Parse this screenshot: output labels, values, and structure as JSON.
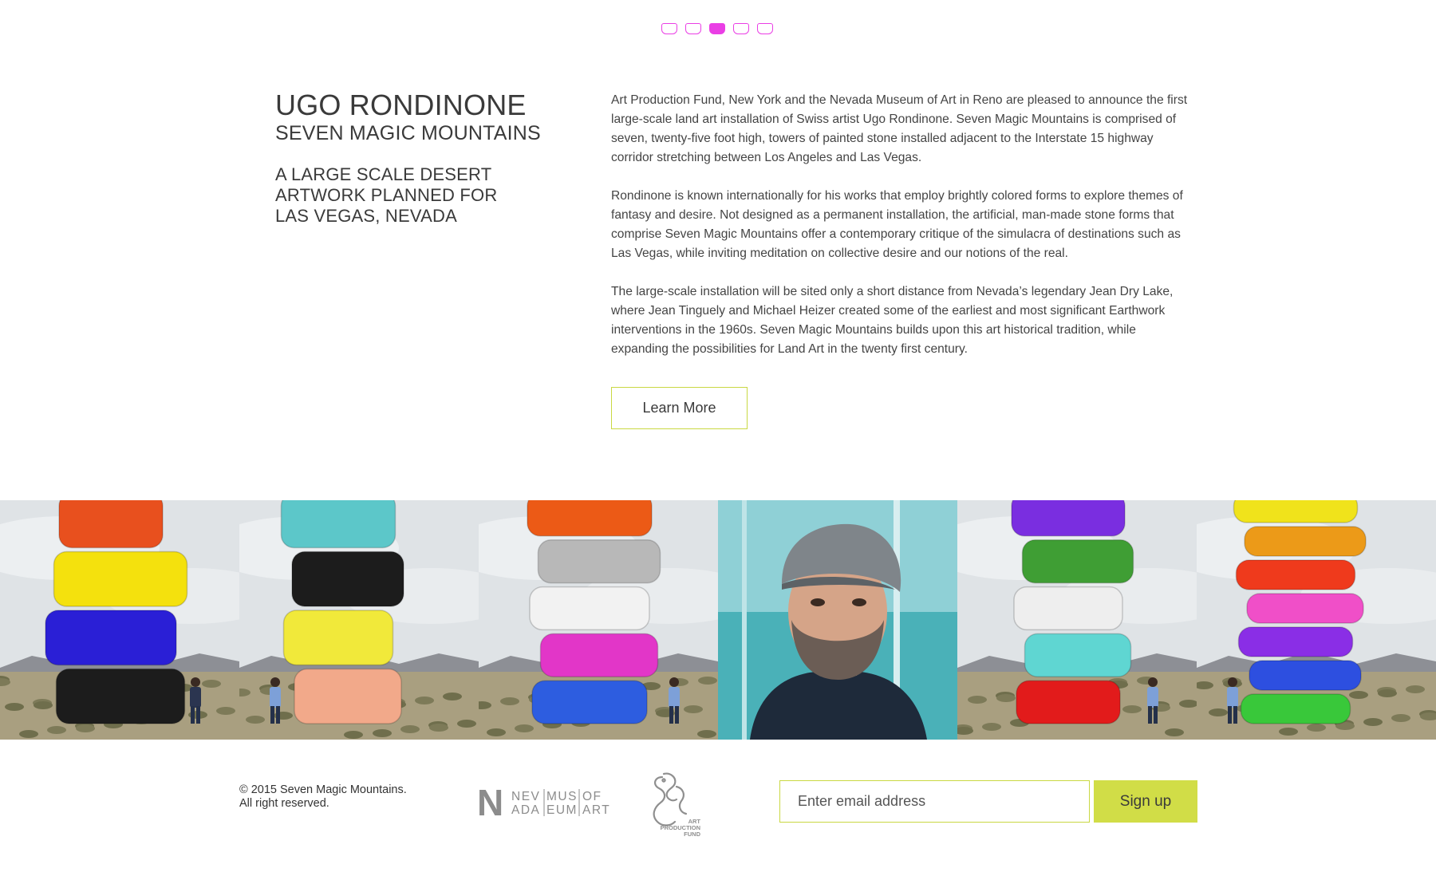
{
  "slider": {
    "count": 5,
    "active_index": 2,
    "accent": "#ea3ee5"
  },
  "heading": {
    "artist": "UGO RONDINONE",
    "title": "SEVEN MAGIC MOUNTAINS",
    "subtitle_lines": [
      "A LARGE SCALE DESERT",
      "ARTWORK PLANNED FOR",
      "LAS VEGAS, NEVADA"
    ]
  },
  "body": {
    "paragraphs": [
      "Art Production Fund, New York and the Nevada Museum of Art in Reno are pleased to announce the first large-scale land art installation of Swiss artist Ugo Rondinone. Seven Magic Mountains is comprised of seven, twenty-five foot high, towers of painted stone installed adjacent to the Interstate 15 highway corridor stretching between Los Angeles and Las Vegas.",
      "Rondinone is known internationally for his works that employ brightly colored forms to explore themes of fantasy and desire. Not designed as a permanent installation, the artificial, man-made stone forms that comprise Seven Magic Mountains offer a contemporary critique of the simulacra of destinations such as Las Vegas, while inviting meditation on collective desire and our notions of the real.",
      "The large-scale installation will be sited only a short distance from Nevada’s legendary Jean Dry Lake, where Jean Tinguely and Michael Heizer created some of the earliest and most significant Earthwork interventions in the 1960s. Seven Magic Mountains builds upon this art historical tradition, while expanding the possibilities for Land Art in the twenty first century."
    ],
    "learn_more_label": "Learn More"
  },
  "gallery": {
    "tiles": [
      {
        "kind": "tower",
        "stones": [
          "#e8501e",
          "#f4e10d",
          "#2a1fd6",
          "#1c1c1c"
        ]
      },
      {
        "kind": "tower",
        "stones": [
          "#5cc7c9",
          "#1c1c1c",
          "#f1e93a",
          "#f2a98a"
        ]
      },
      {
        "kind": "tower",
        "stones": [
          "#ec5a16",
          "#b8b8b8",
          "#f2f2f2",
          "#e236c8",
          "#2d5de0"
        ]
      },
      {
        "kind": "portrait"
      },
      {
        "kind": "tower",
        "stones": [
          "#7a2ee0",
          "#3f9e34",
          "#eeeeee",
          "#5fd6d2",
          "#e21b1b"
        ]
      },
      {
        "kind": "tower",
        "stones": [
          "#f0e31b",
          "#ec9a18",
          "#ef3a1c",
          "#f04fc8",
          "#8a2ee6",
          "#2d4fe0",
          "#39c83a"
        ]
      }
    ]
  },
  "footer": {
    "copyright_lines": [
      "© 2015 Seven Magic Mountains.",
      "All right reserved."
    ],
    "nevada_logo": {
      "letter": "N",
      "words": [
        "NEV",
        "ADA",
        "MUS",
        "EUM",
        "OF",
        "ART"
      ]
    },
    "apf_logo": {
      "lines": [
        "ART",
        "PRODUCTION",
        "FUND"
      ]
    },
    "email_placeholder": "Enter email address",
    "signup_label": "Sign up",
    "accent": "#d1dd47"
  }
}
